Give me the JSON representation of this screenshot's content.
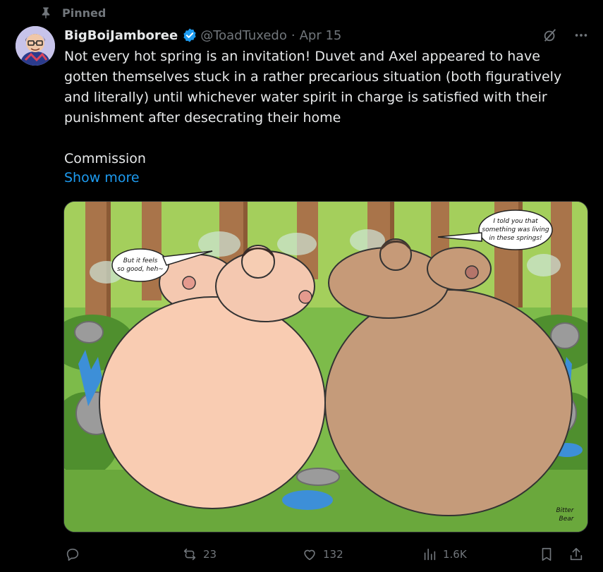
{
  "pinned": {
    "label": "Pinned",
    "icon": "pin-icon"
  },
  "author": {
    "display_name": "BigBoiJamboree",
    "handle": "@ToadTuxedo",
    "separator": "·",
    "date": "Apr 15",
    "verified": true
  },
  "tweet": {
    "text": "Not every hot spring is an invitation! Duvet and Axel appeared to have gotten themselves stuck in a rather precarious situation (both figuratively and literally) until whichever water spirit in charge is satisfied with their punishment after desecrating their home\n\nCommission",
    "show_more": "Show more"
  },
  "media": {
    "speech_left": [
      "But it feels",
      "so good, heh~"
    ],
    "speech_right": [
      "I told you that",
      "something was living",
      "in these springs!"
    ],
    "signature": [
      "Bitter",
      "Bear"
    ]
  },
  "actions": {
    "reply": {
      "icon": "reply-icon",
      "count": ""
    },
    "repost": {
      "icon": "repost-icon",
      "count": "23"
    },
    "like": {
      "icon": "heart-icon",
      "count": "132"
    },
    "views": {
      "icon": "views-icon",
      "count": "1.6K"
    },
    "bookmark": {
      "icon": "bookmark-icon"
    },
    "share": {
      "icon": "share-icon"
    }
  },
  "colors": {
    "accent": "#1d9bf0",
    "muted": "#71767b",
    "text": "#e7e9ea",
    "background": "#000000"
  }
}
